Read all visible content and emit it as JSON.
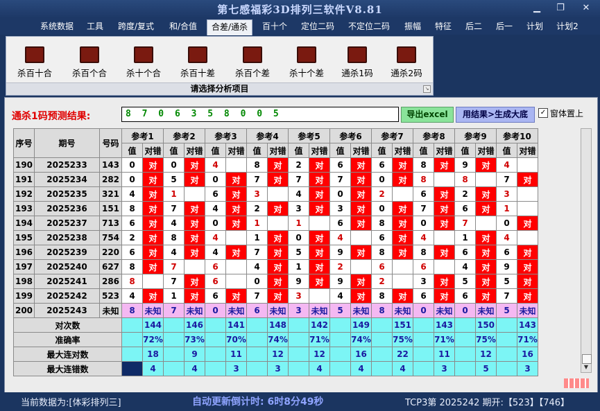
{
  "window": {
    "title": "第七感福彩3D排列三软件V8.81"
  },
  "menu": [
    "系统数据",
    "工具",
    "跨度/复式",
    "和/合值",
    "合差/通杀",
    "百十个",
    "定位二码",
    "不定位二码",
    "振幅",
    "特征",
    "后二",
    "后一",
    "计划",
    "计划2"
  ],
  "menu_active": 4,
  "ribbon": {
    "items": [
      "杀百十合",
      "杀百个合",
      "杀十个合",
      "杀百十差",
      "杀百个差",
      "杀十个差",
      "通杀1码",
      "通杀2码"
    ],
    "caption": "请选择分析项目"
  },
  "prediction": {
    "label": "通杀1码预测结果:",
    "value": "8 7 0 6 3 5 8 0 0 5",
    "excel_button": "导出excel",
    "generate_button": "用结果>生成大底",
    "checkbox_label": "窗体置上",
    "checkbox_mark": "✓"
  },
  "table": {
    "headers": [
      "序号",
      "期号",
      "号码"
    ],
    "ref_headers": [
      "参考1",
      "参考2",
      "参考3",
      "参考4",
      "参考5",
      "参考6",
      "参考7",
      "参考8",
      "参考9",
      "参考10"
    ],
    "sub_headers": [
      "值",
      "对错"
    ],
    "correct": "对",
    "rows": [
      {
        "seq": "190",
        "issue": "2025233",
        "num": "143",
        "vals": [
          "0",
          "0",
          "4",
          "8",
          "2",
          "6",
          "6",
          "8",
          "9",
          "4"
        ],
        "hits": [
          1,
          1,
          0,
          1,
          1,
          1,
          1,
          1,
          1,
          0
        ]
      },
      {
        "seq": "191",
        "issue": "2025234",
        "num": "282",
        "vals": [
          "0",
          "5",
          "0",
          "7",
          "7",
          "7",
          "0",
          "8",
          "8",
          "7"
        ],
        "hits": [
          1,
          1,
          1,
          1,
          1,
          1,
          1,
          0,
          0,
          1
        ]
      },
      {
        "seq": "192",
        "issue": "2025235",
        "num": "321",
        "vals": [
          "4",
          "1",
          "6",
          "3",
          "4",
          "0",
          "2",
          "6",
          "2",
          "3"
        ],
        "hits": [
          1,
          0,
          1,
          0,
          1,
          1,
          0,
          1,
          1,
          0
        ]
      },
      {
        "seq": "193",
        "issue": "2025236",
        "num": "151",
        "vals": [
          "8",
          "7",
          "4",
          "2",
          "3",
          "3",
          "0",
          "7",
          "6",
          "1"
        ],
        "hits": [
          1,
          1,
          1,
          1,
          1,
          1,
          1,
          1,
          1,
          0
        ]
      },
      {
        "seq": "194",
        "issue": "2025237",
        "num": "713",
        "vals": [
          "6",
          "4",
          "0",
          "1",
          "1",
          "6",
          "8",
          "0",
          "7",
          "0"
        ],
        "hits": [
          1,
          1,
          1,
          0,
          0,
          1,
          1,
          1,
          0,
          1
        ]
      },
      {
        "seq": "195",
        "issue": "2025238",
        "num": "754",
        "vals": [
          "2",
          "8",
          "4",
          "1",
          "0",
          "4",
          "6",
          "4",
          "1",
          "4"
        ],
        "hits": [
          1,
          1,
          0,
          1,
          1,
          0,
          1,
          0,
          1,
          0
        ]
      },
      {
        "seq": "196",
        "issue": "2025239",
        "num": "220",
        "vals": [
          "6",
          "4",
          "4",
          "7",
          "5",
          "9",
          "8",
          "8",
          "6",
          "6"
        ],
        "hits": [
          1,
          1,
          1,
          1,
          1,
          1,
          1,
          1,
          1,
          1
        ]
      },
      {
        "seq": "197",
        "issue": "2025240",
        "num": "627",
        "vals": [
          "8",
          "7",
          "6",
          "4",
          "1",
          "2",
          "6",
          "6",
          "4",
          "9"
        ],
        "hits": [
          1,
          0,
          0,
          1,
          1,
          0,
          0,
          0,
          1,
          1
        ]
      },
      {
        "seq": "198",
        "issue": "2025241",
        "num": "286",
        "vals": [
          "8",
          "7",
          "6",
          "0",
          "9",
          "9",
          "2",
          "3",
          "5",
          "5"
        ],
        "hits": [
          0,
          1,
          0,
          1,
          1,
          1,
          0,
          1,
          1,
          1
        ]
      },
      {
        "seq": "199",
        "issue": "2025242",
        "num": "523",
        "vals": [
          "4",
          "1",
          "6",
          "7",
          "3",
          "4",
          "8",
          "6",
          "6",
          "7"
        ],
        "hits": [
          1,
          1,
          1,
          1,
          0,
          1,
          1,
          1,
          1,
          1
        ]
      }
    ],
    "current": {
      "seq": "200",
      "issue": "2025243",
      "num": "未知",
      "vals": [
        "8",
        "7",
        "0",
        "6",
        "3",
        "5",
        "8",
        "0",
        "0",
        "5"
      ],
      "status": "未知"
    },
    "summary_labels": [
      "对次数",
      "准确率",
      "最大连对数",
      "最大连错数"
    ],
    "summary": [
      [
        "144",
        "146",
        "141",
        "148",
        "142",
        "149",
        "151",
        "143",
        "150",
        "143"
      ],
      [
        "72%",
        "73%",
        "70%",
        "74%",
        "71%",
        "74%",
        "75%",
        "71%",
        "75%",
        "71%"
      ],
      [
        "18",
        "9",
        "11",
        "12",
        "12",
        "16",
        "22",
        "11",
        "12",
        "16"
      ],
      [
        "4",
        "4",
        "3",
        "3",
        "4",
        "4",
        "4",
        "3",
        "5",
        "3"
      ]
    ]
  },
  "status": {
    "data_source": "当前数据为:[体彩排列三]",
    "countdown": "自动更新倒计时: 6时8分49秒",
    "latest": "TCP3第 2025242 期开:【523】【746】"
  },
  "colors": {
    "hit_red": "#ff0000",
    "current_row": "#f4b8f2",
    "summary_cyan": "#7cf5f5",
    "background": "#1b3560"
  }
}
